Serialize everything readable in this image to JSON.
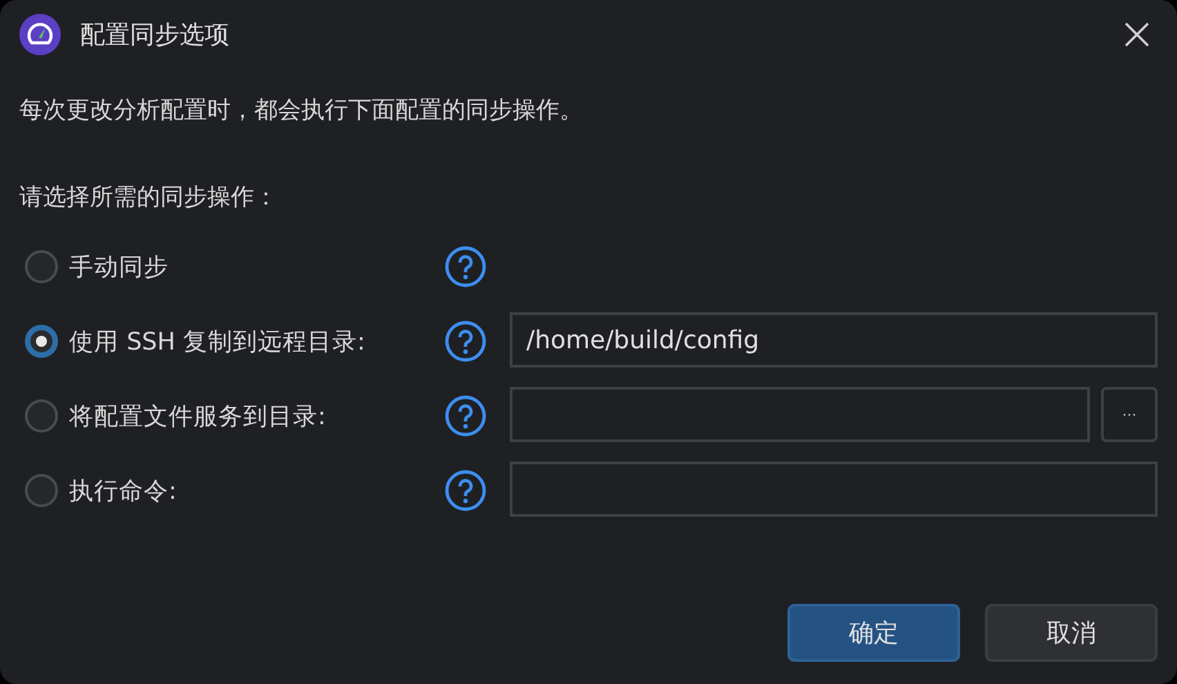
{
  "window": {
    "title": "配置同步选项"
  },
  "description": "每次更改分析配置时，都会执行下面配置的同步操作。",
  "prompt": "请选择所需的同步操作：",
  "options": [
    {
      "label": "手动同步",
      "selected": false,
      "kind": "none"
    },
    {
      "label": "使用 SSH 复制到远程目录:",
      "selected": true,
      "kind": "text",
      "value": "/home/build/config"
    },
    {
      "label": "将配置文件服务到目录:",
      "selected": false,
      "kind": "browse",
      "browse_label": "···"
    },
    {
      "label": "执行命令:",
      "selected": false,
      "kind": "text"
    }
  ],
  "buttons": [
    {
      "label": "确定",
      "kind": "primary"
    },
    {
      "label": "取消",
      "kind": "secondary"
    }
  ]
}
